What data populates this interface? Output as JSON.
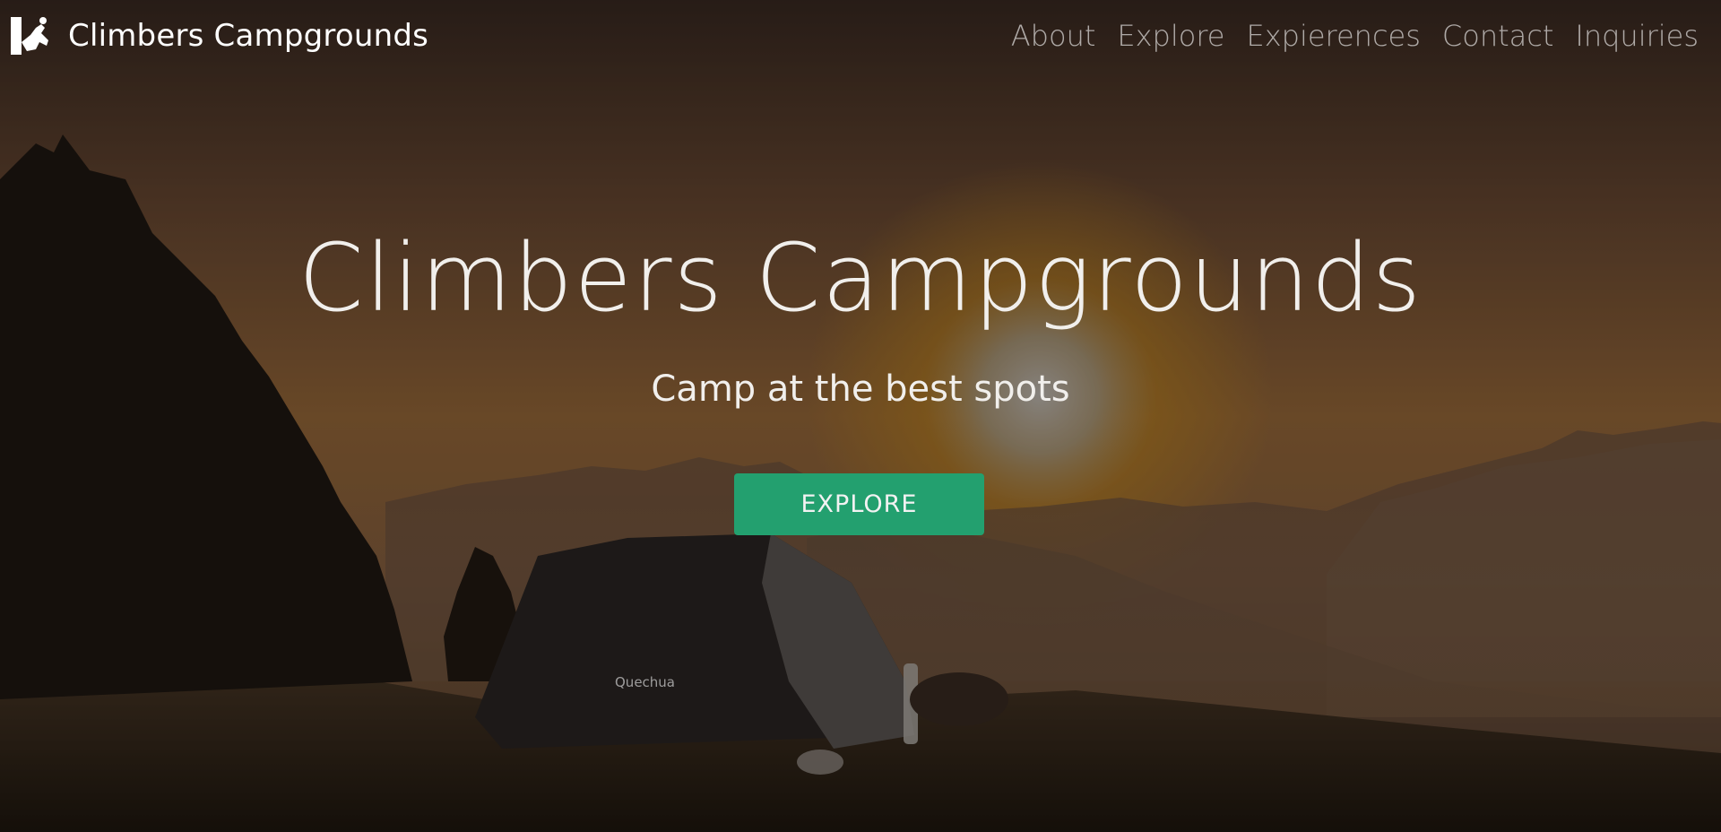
{
  "navbar": {
    "brand_name": "Climbers Campgrounds",
    "logo_icon": "climber-logo-icon",
    "links": [
      {
        "label": "About"
      },
      {
        "label": "Explore"
      },
      {
        "label": "Expierences"
      },
      {
        "label": "Contact"
      },
      {
        "label": "Inquiries"
      }
    ]
  },
  "hero": {
    "title": "Climbers Campgrounds",
    "subtitle": "Camp at the best spots",
    "button_label": "EXPLORE",
    "tent_brand": "Quechua",
    "colors": {
      "button": "#23a06f",
      "overlay": "rgba(0,0,0,0.45)",
      "text": "#f1efec"
    }
  }
}
